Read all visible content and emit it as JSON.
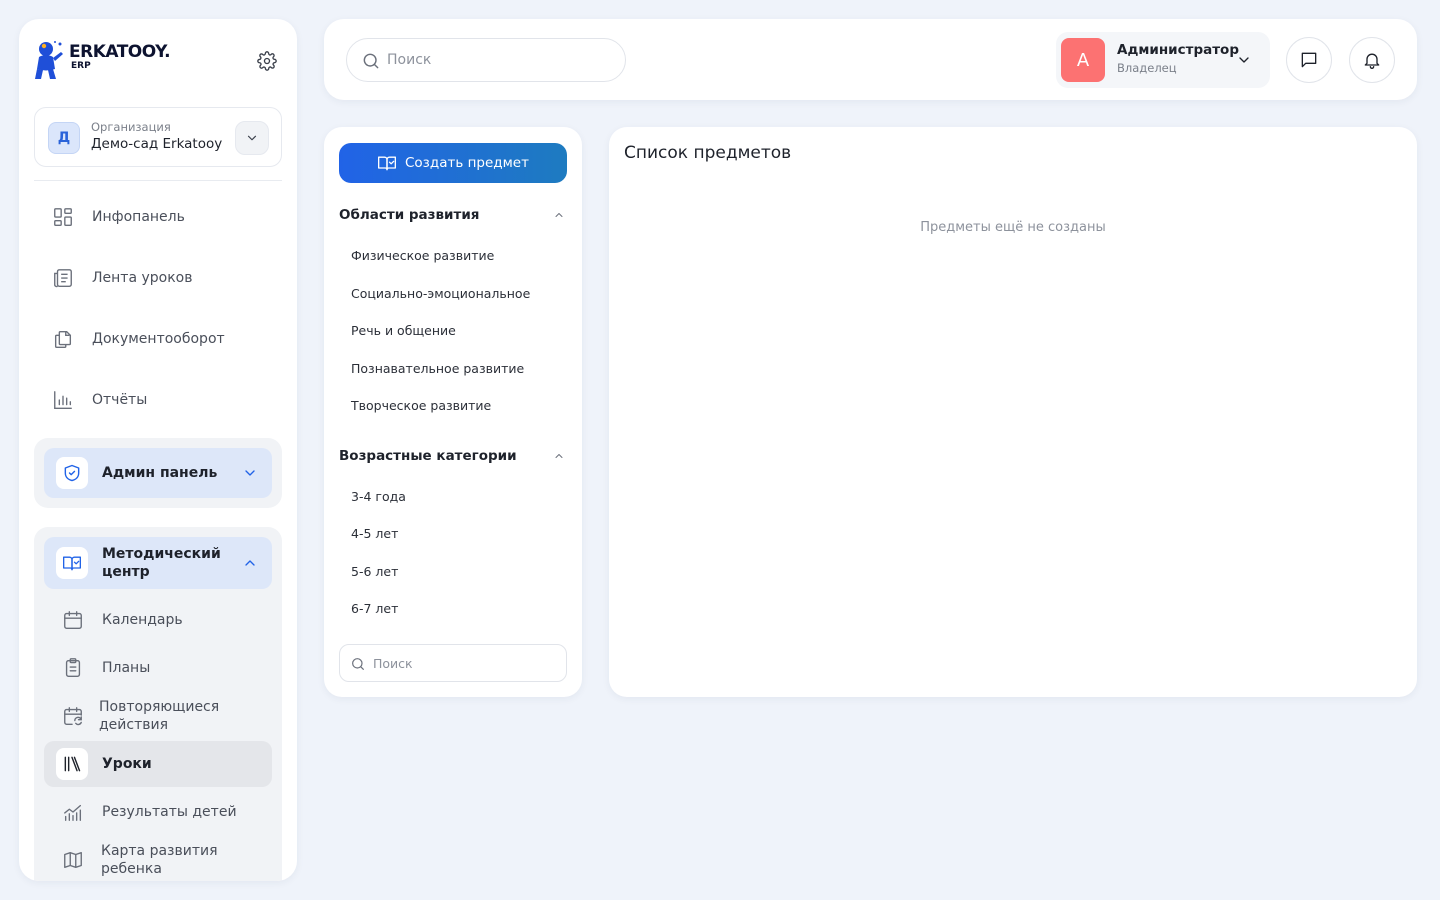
{
  "logo": {
    "title": "ERKATOOY.",
    "subtitle": "ERP"
  },
  "organization": {
    "label": "Организация",
    "name": "Демо-сад Erkatooy",
    "avatar_letter": "Д"
  },
  "sidebar": {
    "items": [
      {
        "label": "Инфопанель",
        "icon": "grid-icon"
      },
      {
        "label": "Лента уроков",
        "icon": "newspaper-icon"
      },
      {
        "label": "Документооборот",
        "icon": "documents-icon"
      },
      {
        "label": "Отчёты",
        "icon": "bar-chart-icon"
      }
    ],
    "admin_group": {
      "label": "Админ панель",
      "icon": "shield-check-icon"
    },
    "methodic_group": {
      "label_line1": "Методический",
      "label_line2": "центр",
      "icon": "book-check-icon",
      "items": [
        {
          "label": "Календарь",
          "icon": "calendar-icon"
        },
        {
          "label": "Планы",
          "icon": "clipboard-icon"
        },
        {
          "label_line1": "Повторяющиеся",
          "label_line2": "действия",
          "icon": "calendar-repeat-icon"
        },
        {
          "label": "Уроки",
          "icon": "library-icon",
          "active": true
        },
        {
          "label": "Результаты детей",
          "icon": "line-chart-icon"
        },
        {
          "label_line1": "Карта развития",
          "label_line2": "ребенка",
          "icon": "map-icon"
        }
      ]
    }
  },
  "header": {
    "search_placeholder": "Поиск",
    "user": {
      "avatar_letter": "А",
      "name": "Администратор",
      "role": "Владелец"
    }
  },
  "filter": {
    "create_button": "Создать предмет",
    "areas_title": "Области развития",
    "areas": [
      "Физическое развитие",
      "Социально-эмоциональное",
      "Речь и общение",
      "Познавательное развитие",
      "Творческое развитие"
    ],
    "ages_title": "Возрастные категории",
    "ages": [
      "3-4 года",
      "4-5 лет",
      "5-6 лет",
      "6-7 лет"
    ],
    "search_placeholder": "Поиск"
  },
  "main": {
    "title": "Список предметов",
    "empty_text": "Предметы ещё не созданы"
  },
  "colors": {
    "accent": "#2163e7",
    "accent_gradient_end": "#1e7bc0",
    "user_avatar": "#fc7272",
    "background": "#eff3fa",
    "group_head": "#dde7f9"
  }
}
